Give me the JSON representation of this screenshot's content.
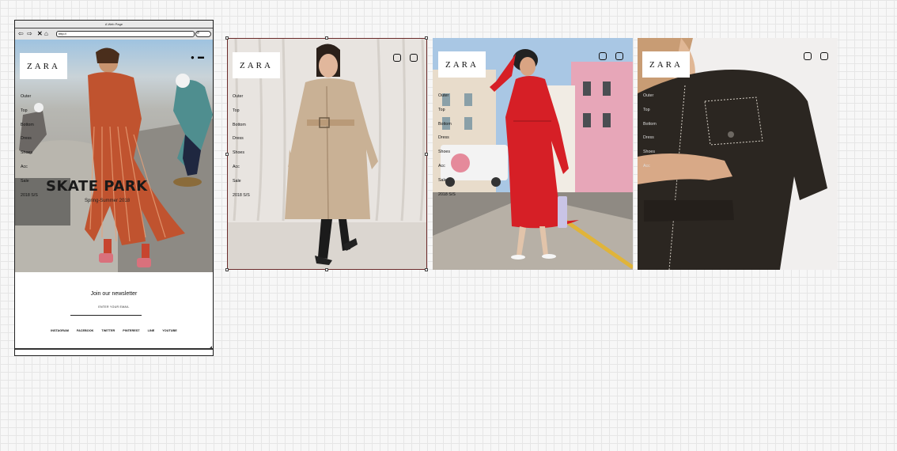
{
  "browser": {
    "title": "A Web Page",
    "url": "http://",
    "nav_icons": [
      "back-arrow-icon",
      "forward-arrow-icon",
      "close-icon",
      "home-icon"
    ]
  },
  "brand": "ZARA",
  "menu": [
    "Outer",
    "Top",
    "Bottom",
    "Dress",
    "Shoes",
    "Acc",
    "Sale",
    "2018 S/S"
  ],
  "hero": {
    "headline": "SKATE PARK",
    "subline": "Spring-Summer 2018"
  },
  "newsletter": {
    "title": "Join our newsletter",
    "hint": "ENTER YOUR EMAIL",
    "socials": [
      "INSTAGRAM",
      "FACEBOOK",
      "TWITTER",
      "PINTEREST",
      "LINE",
      "YOUTUBE"
    ]
  },
  "panels": [
    {
      "name": "trench-coat",
      "photo_colors": [
        "#e9e5e1",
        "#d8d2cb",
        "#b99a72",
        "#222222"
      ]
    },
    {
      "name": "red-dress",
      "photo_colors": [
        "#a7c7e6",
        "#e7a9b9",
        "#d61f26",
        "#8c8780"
      ]
    },
    {
      "name": "black-jumpsuit",
      "photo_colors": [
        "#f1efee",
        "#2a2520",
        "#c89c74"
      ]
    }
  ],
  "colors": {
    "accent_red": "#d61f26",
    "frame": "#222222"
  }
}
